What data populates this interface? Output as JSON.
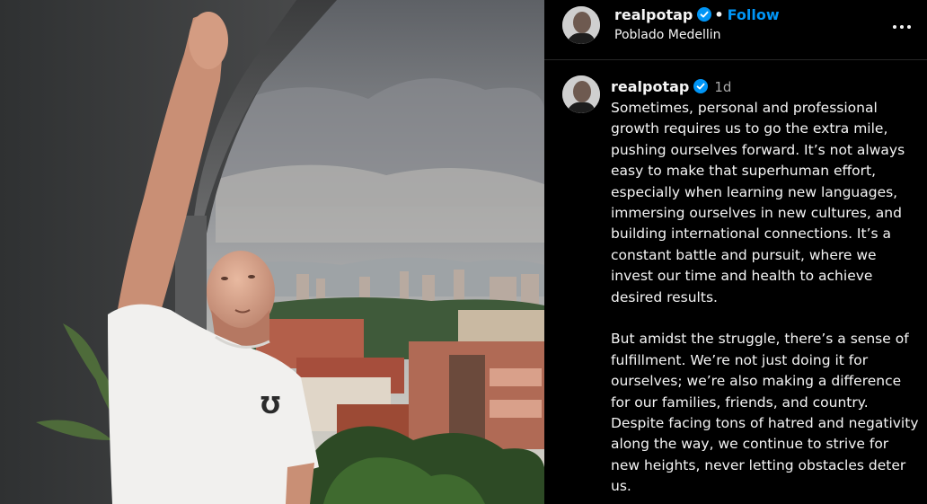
{
  "header": {
    "username": "realpotap",
    "separator": "•",
    "follow_label": "Follow",
    "location": "Poblado Medellin"
  },
  "caption": {
    "username": "realpotap",
    "timestamp": "1d",
    "paragraphs": [
      "Sometimes, personal and professional growth requires us to go the extra mile, pushing ourselves forward. It’s not always easy to make that superhuman effort, especially when learning new languages, immersing ourselves in new cultures, and building international connections. It’s a constant battle and pursuit, where we invest our time and health to achieve desired results.",
      "But amidst the struggle, there’s a sense of fulfillment. We’re not just doing it for ourselves; we’re also making a difference for our families, friends, and country. Despite facing tons of hatred and negativity along the way, we continue to strive for new heights, never letting obstacles deter us."
    ]
  },
  "icons": {
    "verified": "verified-badge-icon",
    "more": "more-options-icon"
  },
  "colors": {
    "background": "#000000",
    "follow_blue": "#0095f6",
    "verified_blue": "#0095f6",
    "muted_text": "#a8a8a8"
  }
}
